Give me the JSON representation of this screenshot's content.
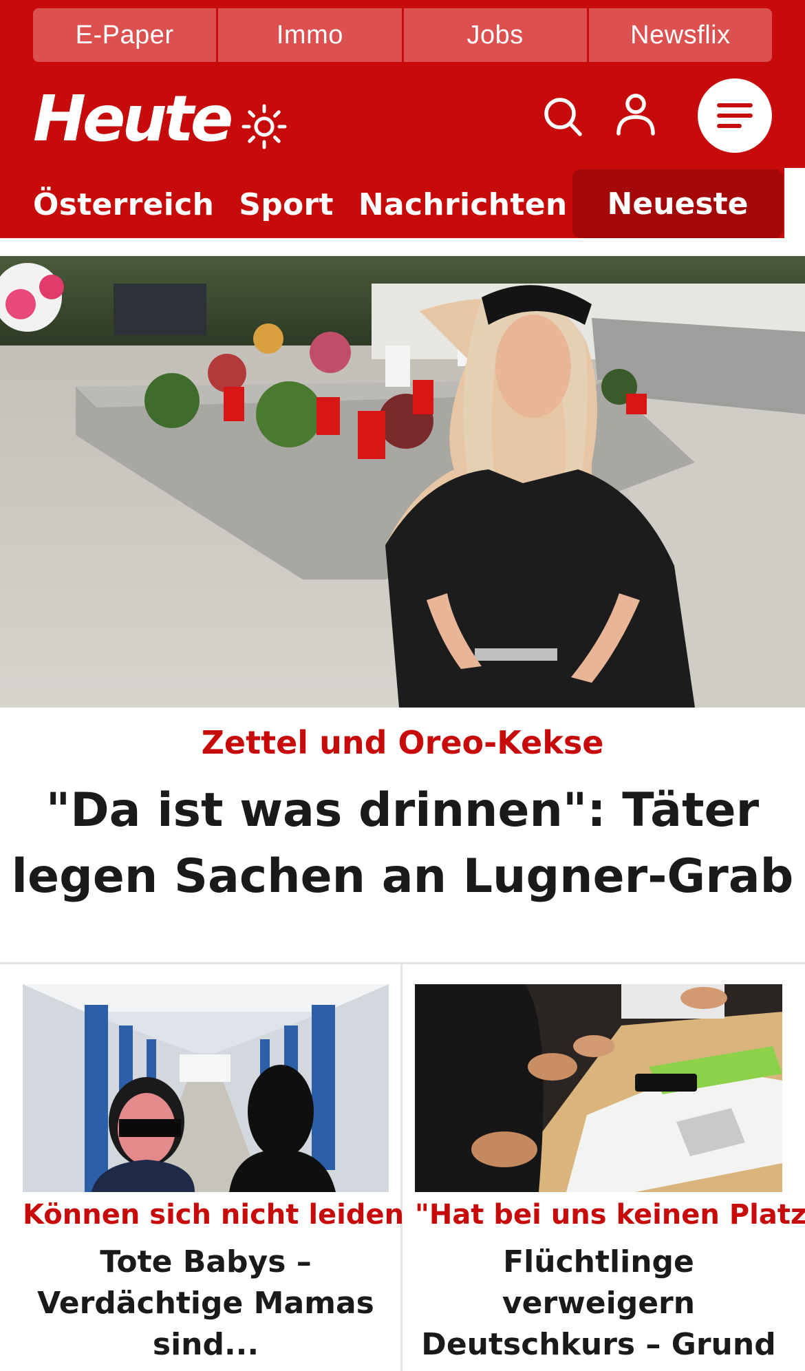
{
  "colors": {
    "brand_red": "#c70a0a",
    "active_tab": "#a50808",
    "top_link_bg": "#dc5050"
  },
  "top_links": [
    "E-Paper",
    "Immo",
    "Jobs",
    "Newsflix"
  ],
  "header": {
    "logo": "Heute",
    "icons": [
      "sun-icon",
      "search-icon",
      "user-icon",
      "menu-icon"
    ]
  },
  "nav": {
    "items": [
      "Österreich",
      "Sport",
      "Nachrichten"
    ],
    "active": "Neueste"
  },
  "hero": {
    "kicker": "Zettel und Oreo-Kekse",
    "title": "\"Da ist was drinnen\": Täter legen Sachen an Lugner-Grab",
    "image": "Grave with candles and flowers, woman in black with veil"
  },
  "teasers": [
    {
      "kicker": "Können sich nicht leiden",
      "title": "Tote Babys – Verdächtige Mamas sind...",
      "image": "Prison corridor with two women"
    },
    {
      "kicker": "\"Hat bei uns keinen Platz\"",
      "title": "Flüchtlinge verweigern Deutschkurs – Grund schockiert",
      "image": "People writing at a table in class"
    }
  ]
}
